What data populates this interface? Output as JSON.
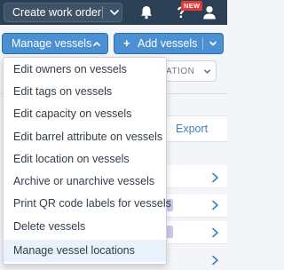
{
  "navbar": {
    "create_label": "Create work order",
    "new_badge": "NEW"
  },
  "toolbar": {
    "manage_label": "Manage vessels",
    "add_label": "Add vessels",
    "add_plus": "+"
  },
  "background": {
    "filter_text": "ATION",
    "export_label": "Export"
  },
  "menu": {
    "items": [
      {
        "label": "Edit owners on vessels"
      },
      {
        "label": "Edit tags on vessels"
      },
      {
        "label": "Edit capacity on vessels"
      },
      {
        "label": "Edit barrel attribute on vessels"
      },
      {
        "label": "Edit location on vessels"
      },
      {
        "label": "Archive or unarchive vessels"
      },
      {
        "label": "Print QR code labels for vessels"
      },
      {
        "label": "Delete vessels"
      },
      {
        "label": "Manage vessel locations"
      }
    ],
    "highlighted_index": 8
  },
  "colors": {
    "navbar_bg": "#2b3f55",
    "primary_button": "#4a90d2",
    "badge_red": "#e23b35",
    "link_blue": "#3c7fc0",
    "highlight_bg": "#e9f2fb"
  }
}
